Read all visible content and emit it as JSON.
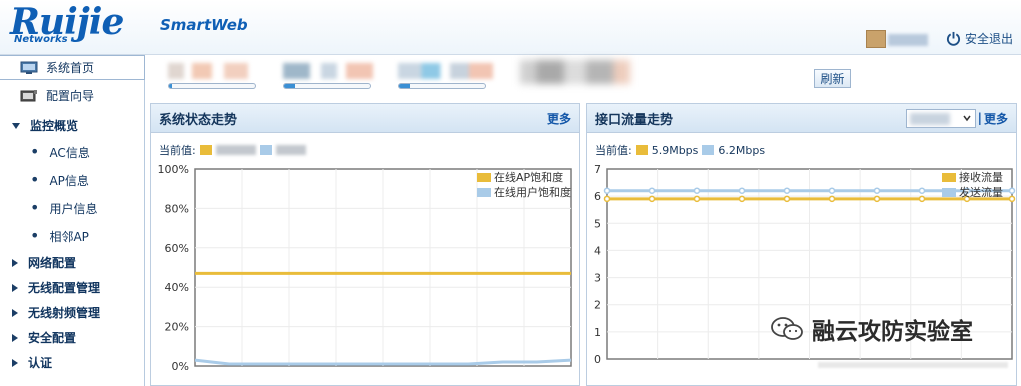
{
  "header": {
    "brand": "Ruijie",
    "brand_sub": "Networks",
    "product": "SmartWeb",
    "logout_label": "安全退出"
  },
  "sidebar": {
    "items": [
      {
        "label": "系统首页"
      },
      {
        "label": "配置向导"
      },
      {
        "label": "监控概览"
      },
      {
        "label": "AC信息"
      },
      {
        "label": "AP信息"
      },
      {
        "label": "用户信息"
      },
      {
        "label": "相邻AP"
      },
      {
        "label": "网络配置"
      },
      {
        "label": "无线配置管理"
      },
      {
        "label": "无线射频管理"
      },
      {
        "label": "安全配置"
      },
      {
        "label": "认证"
      }
    ]
  },
  "top": {
    "refresh_label": "刷新",
    "progress": [
      0.03,
      0.13,
      0.13
    ]
  },
  "panels": {
    "left": {
      "title": "系统状态走势",
      "more": "更多",
      "current_label": "当前值:"
    },
    "right": {
      "title": "接口流量走势",
      "more": "更多",
      "current_label": "当前值:",
      "val1": "5.9Mbps",
      "val2": "6.2Mbps"
    }
  },
  "colors": {
    "series_a": "#e9bc3a",
    "series_b": "#a9cbe8",
    "accent": "#1457a8"
  },
  "chart_data": [
    {
      "type": "line",
      "ylim": [
        0,
        100
      ],
      "yticks": [
        "100%",
        "80%",
        "60%",
        "40%",
        "20%",
        "0%"
      ],
      "series": [
        {
          "name": "在线AP饱和度",
          "values": [
            47,
            47,
            47,
            47,
            47,
            47,
            47,
            47,
            47,
            47,
            47,
            47
          ]
        },
        {
          "name": "在线用户饱和度",
          "values": [
            3,
            1,
            1,
            1,
            1,
            1,
            1,
            1,
            1,
            2,
            2,
            3
          ]
        }
      ]
    },
    {
      "type": "line",
      "ylim": [
        0,
        7
      ],
      "yticks": [
        "7",
        "6",
        "5",
        "4",
        "3",
        "2",
        "1",
        "0"
      ],
      "series": [
        {
          "name": "接收流量",
          "values": [
            5.9,
            5.9,
            5.9,
            5.9,
            5.9,
            5.9,
            5.9,
            5.9,
            5.9,
            5.9
          ]
        },
        {
          "name": "发送流量",
          "values": [
            6.2,
            6.2,
            6.2,
            6.2,
            6.2,
            6.2,
            6.2,
            6.2,
            6.2,
            6.2
          ]
        }
      ]
    }
  ],
  "watermark": "融云攻防实验室"
}
